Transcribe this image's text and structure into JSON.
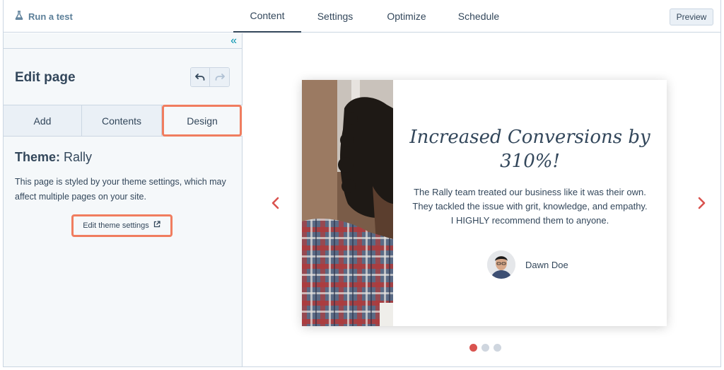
{
  "topbar": {
    "run_test_label": "Run a test",
    "tabs": [
      {
        "label": "Content",
        "active": true
      },
      {
        "label": "Settings",
        "active": false
      },
      {
        "label": "Optimize",
        "active": false
      },
      {
        "label": "Schedule",
        "active": false
      }
    ],
    "preview_label": "Preview"
  },
  "sidebar": {
    "title": "Edit page",
    "tabs": [
      {
        "label": "Add"
      },
      {
        "label": "Contents"
      },
      {
        "label": "Design",
        "active": true
      }
    ],
    "theme_prefix": "Theme:",
    "theme_name": "Rally",
    "description": "This page is styled by your theme settings, which may affect multiple pages on your site.",
    "edit_theme_label": "Edit theme settings"
  },
  "testimonial": {
    "headline": "Increased Conversions by 310%!",
    "quote": "The Rally team treated our business like it was their own. They tackled the issue with grit, knowledge, and empathy. I HIGHLY recommend them to anyone.",
    "author": "Dawn Doe"
  },
  "carousel": {
    "slide_count": 3,
    "active_slide": 1
  },
  "colors": {
    "text": "#33475b",
    "accent_link": "#0091ae",
    "highlight": "#f07d5f",
    "arrow": "#d9534f",
    "border": "#cbd6e2"
  }
}
